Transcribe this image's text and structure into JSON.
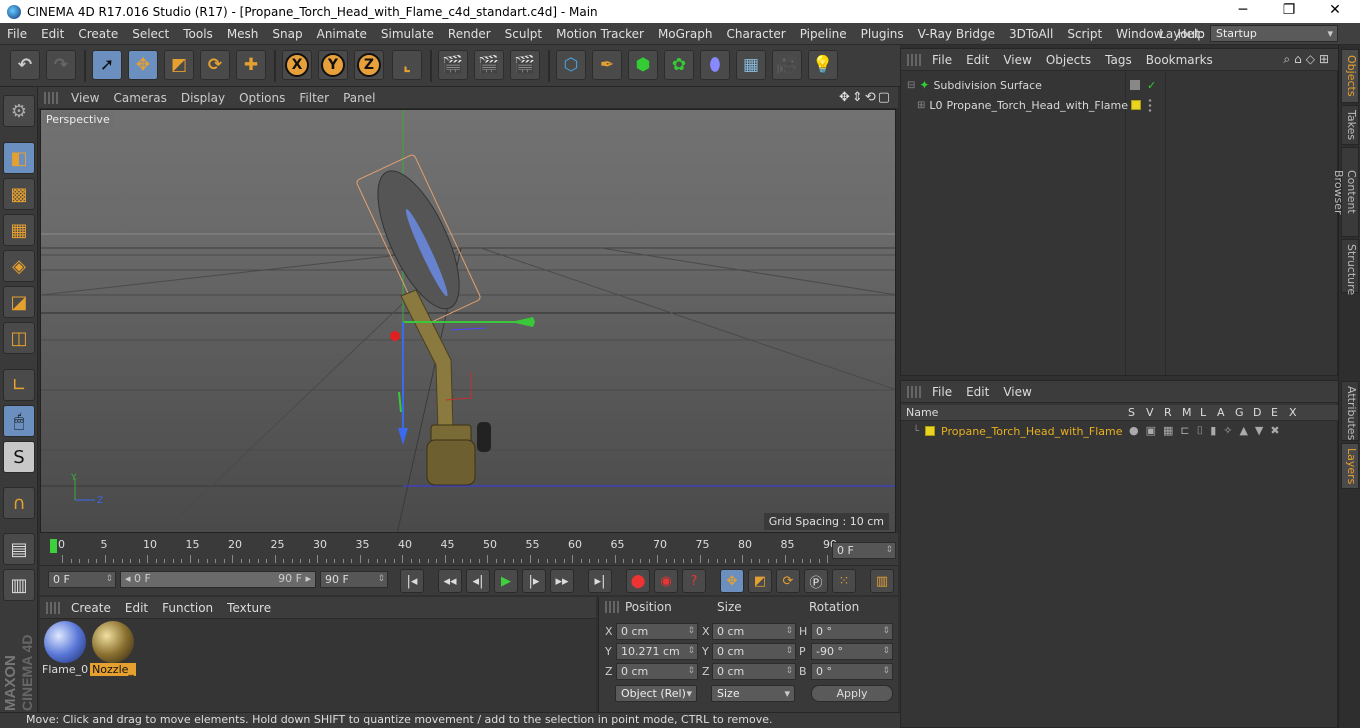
{
  "window": {
    "title": "CINEMA 4D R17.016 Studio (R17) - [Propane_Torch_Head_with_Flame_c4d_standart.c4d] - Main",
    "minimize": "─",
    "maximize": "❐",
    "close": "✕"
  },
  "menu": [
    "File",
    "Edit",
    "Create",
    "Select",
    "Tools",
    "Mesh",
    "Snap",
    "Animate",
    "Simulate",
    "Render",
    "Sculpt",
    "Motion Tracker",
    "MoGraph",
    "Character",
    "Pipeline",
    "Plugins",
    "V-Ray Bridge",
    "3DToAll",
    "Script",
    "Window",
    "Help"
  ],
  "layout": {
    "label": "Layout:",
    "value": "Startup"
  },
  "toolbar": {
    "x": "X",
    "y": "Y",
    "z": "Z"
  },
  "viewport": {
    "menu": [
      "View",
      "Cameras",
      "Display",
      "Options",
      "Filter",
      "Panel"
    ],
    "label": "Perspective",
    "grid_spacing": "Grid Spacing : 10 cm",
    "nav_icons": "✥⇕⟲▢"
  },
  "timeline": {
    "ticks": [
      "0",
      "5",
      "10",
      "15",
      "20",
      "25",
      "30",
      "35",
      "40",
      "45",
      "50",
      "55",
      "60",
      "65",
      "70",
      "75",
      "80",
      "85",
      "90"
    ],
    "end_field": "0 F"
  },
  "playbar": {
    "start": "0 F",
    "range_start": "◂ 0 F",
    "range_end": "90 F ▸",
    "end": "90 F"
  },
  "materials": {
    "menu": [
      "Create",
      "Edit",
      "Function",
      "Texture"
    ],
    "items": [
      {
        "name": "Flame_0"
      },
      {
        "name": "Nozzle_"
      }
    ]
  },
  "coordinates": {
    "headers": {
      "position": "Position",
      "size": "Size",
      "rotation": "Rotation"
    },
    "rows": [
      {
        "axis": "X",
        "pos": "0 cm",
        "size_axis": "X",
        "size": "0 cm",
        "rot_axis": "H",
        "rot": "0 °"
      },
      {
        "axis": "Y",
        "pos": "10.271 cm",
        "size_axis": "Y",
        "size": "0 cm",
        "rot_axis": "P",
        "rot": "-90 °"
      },
      {
        "axis": "Z",
        "pos": "0 cm",
        "size_axis": "Z",
        "size": "0 cm",
        "rot_axis": "B",
        "rot": "0 °"
      }
    ],
    "mode": "Object (Rel)",
    "size_mode": "Size",
    "apply": "Apply"
  },
  "status": "Move: Click and drag to move elements. Hold down SHIFT to quantize movement / add to the selection in point mode, CTRL to remove.",
  "object_manager": {
    "menu": [
      "File",
      "Edit",
      "View",
      "Objects",
      "Tags",
      "Bookmarks"
    ],
    "objects": [
      {
        "name": "Subdivision Surface",
        "color": "#c8a020"
      },
      {
        "name": "Propane_Torch_Head_with_Flame",
        "color": "#e8b020"
      }
    ]
  },
  "layer_manager": {
    "menu": [
      "File",
      "Edit",
      "View"
    ],
    "columns": [
      "Name",
      "S",
      "V",
      "R",
      "M",
      "L",
      "A",
      "G",
      "D",
      "E",
      "X"
    ],
    "layers": [
      {
        "name": "Propane_Torch_Head_with_Flame"
      }
    ]
  },
  "side_tabs": [
    "Objects",
    "Takes",
    "Content Browser",
    "Structure",
    "Attributes",
    "Layers"
  ],
  "brand": {
    "maxon": "MAXON",
    "c4d": "CINEMA 4D"
  },
  "colors": {
    "accent": "#e6a030",
    "selected": "#6b8fbf",
    "layer": "#e8d41e"
  }
}
